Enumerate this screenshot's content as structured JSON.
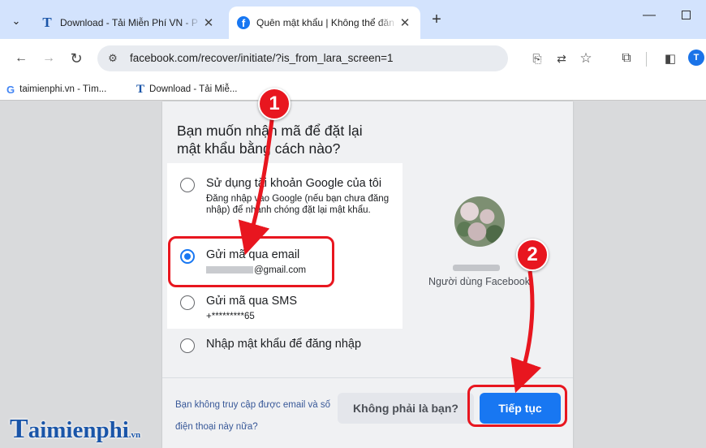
{
  "browser": {
    "tabs": [
      {
        "title": "Download - Tải Miễn Phí VN - P",
        "favicon": "t-logo-icon",
        "active": false
      },
      {
        "title": "Quên mật khẩu | Không thể đăn",
        "favicon": "facebook-icon",
        "active": true
      }
    ],
    "url": "facebook.com/recover/initiate/?is_from_lara_screen=1",
    "profile_initial": "T",
    "bookmarks": [
      {
        "label": "taimienphi.vn - Tìm...",
        "icon": "google-icon"
      },
      {
        "label": "Download - Tải Miễ...",
        "icon": "t-logo-icon"
      }
    ]
  },
  "recover": {
    "question": "Bạn muốn nhận mã để đặt lại mật khẩu bằng cách nào?",
    "options": [
      {
        "label": "Sử dụng tài khoản Google của tôi",
        "sub": "Đăng nhập vào Google (nếu bạn chưa đăng nhập) để nhanh chóng đặt lại mật khẩu.",
        "checked": false
      },
      {
        "label": "Gửi mã qua email",
        "sub": "@gmail.com",
        "checked": true
      },
      {
        "label": "Gửi mã qua SMS",
        "sub": "+*********65",
        "checked": false
      },
      {
        "label": "Nhập mật khẩu để đăng nhập",
        "sub": "",
        "checked": false
      }
    ],
    "user_label": "Người dùng Facebook",
    "footer_link": "Bạn không truy cập được email và số điện thoại này nữa?",
    "not_you_button": "Không phải là bạn?",
    "continue_button": "Tiếp tục"
  },
  "annotations": {
    "step1": "1",
    "step2": "2",
    "color": "#e8161f"
  },
  "watermark": {
    "initial": "T",
    "text": "aimienphi",
    "suffix": ".vn"
  },
  "colors": {
    "facebook_blue": "#1877f2",
    "tab_strip": "#d3e3fd",
    "page_bg": "#d9dadc"
  }
}
